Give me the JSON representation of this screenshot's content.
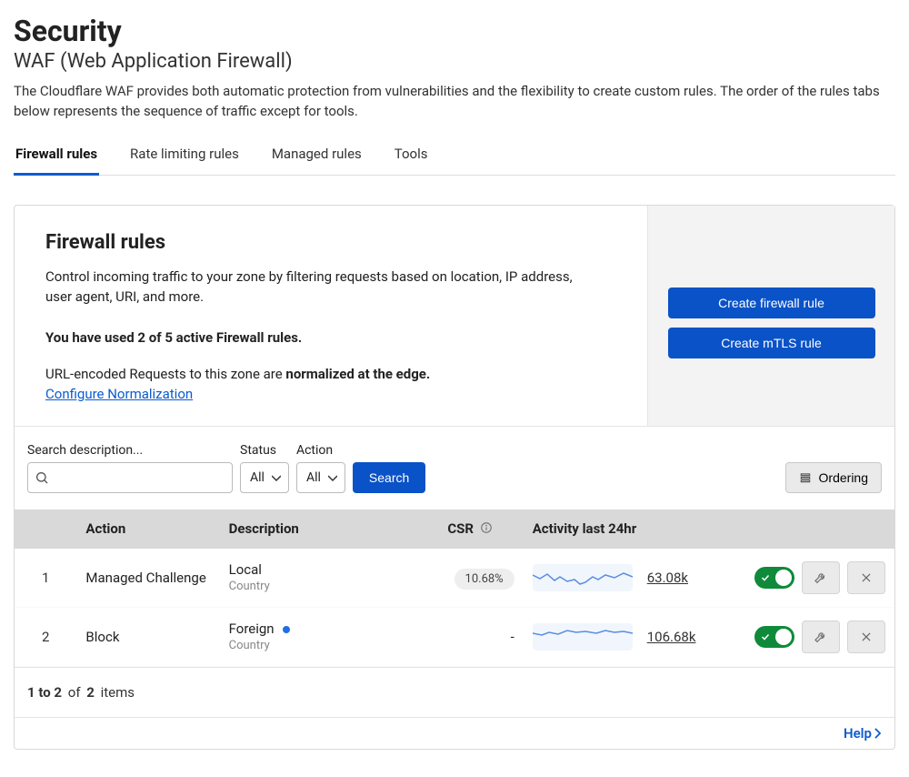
{
  "page": {
    "title": "Security",
    "subtitle": "WAF (Web Application Firewall)",
    "description": "The Cloudflare WAF provides both automatic protection from vulnerabilities and the flexibility to create custom rules. The order of the rules tabs below represents the sequence of traffic except for tools."
  },
  "tabs": [
    {
      "label": "Firewall rules",
      "active": true
    },
    {
      "label": "Rate limiting rules"
    },
    {
      "label": "Managed rules"
    },
    {
      "label": "Tools"
    }
  ],
  "panel": {
    "heading": "Firewall rules",
    "intro": "Control incoming traffic to your zone by filtering requests based on location, IP address, user agent, URI, and more.",
    "usage": "You have used 2 of 5 active Firewall rules.",
    "normalize_prefix": "URL-encoded Requests to this zone are ",
    "normalize_strong": "normalized at the edge.",
    "configure_link": "Configure Normalization",
    "create_fw_btn": "Create firewall rule",
    "create_mtls_btn": "Create mTLS rule"
  },
  "filters": {
    "search_label": "Search description...",
    "search_value": "",
    "status_label": "Status",
    "status_value": "All",
    "action_label": "Action",
    "action_value": "All",
    "search_btn": "Search",
    "ordering_btn": "Ordering"
  },
  "table": {
    "headers": {
      "action": "Action",
      "description": "Description",
      "csr": "CSR",
      "activity": "Activity last 24hr"
    },
    "rows": [
      {
        "idx": "1",
        "action": "Managed Challenge",
        "desc_title": "Local",
        "desc_sub": "Country",
        "dot": false,
        "csr": "10.68%",
        "csr_pill": true,
        "count": "63.08k",
        "enabled": true
      },
      {
        "idx": "2",
        "action": "Block",
        "desc_title": "Foreign",
        "desc_sub": "Country",
        "dot": true,
        "csr": "-",
        "csr_pill": false,
        "count": "106.68k",
        "enabled": true
      }
    ]
  },
  "footer": {
    "range_from": "1",
    "range_to": "2",
    "of_word": "of",
    "total": "2",
    "items_word": "items"
  },
  "help_link": "Help"
}
